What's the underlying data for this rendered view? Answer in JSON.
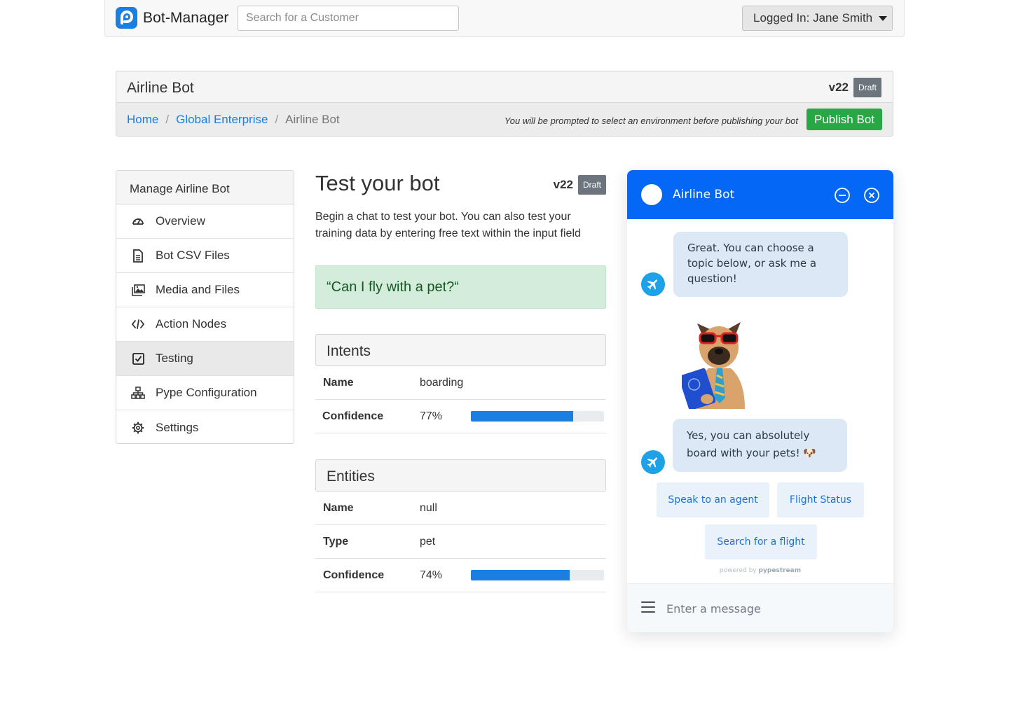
{
  "app": {
    "brand": "Bot-Manager",
    "search_placeholder": "Search for a Customer",
    "user_label": "Logged In: Jane Smith"
  },
  "bot_header": {
    "title": "Airline Bot",
    "version": "v22",
    "status": "Draft",
    "breadcrumb": [
      "Home",
      "Global Enterprise",
      "Airline Bot"
    ],
    "publish_note": "You will be prompted to select an environment before publishing your bot",
    "publish_label": "Publish Bot"
  },
  "sidebar": {
    "title": "Manage Airline Bot",
    "items": [
      {
        "label": "Overview",
        "icon": "dashboard-icon"
      },
      {
        "label": "Bot CSV Files",
        "icon": "file-icon"
      },
      {
        "label": "Media and Files",
        "icon": "images-icon"
      },
      {
        "label": "Action Nodes",
        "icon": "code-icon"
      },
      {
        "label": "Testing",
        "icon": "checkbox-icon",
        "active": true
      },
      {
        "label": "Pype Configuration",
        "icon": "sitemap-icon"
      },
      {
        "label": "Settings",
        "icon": "gear-icon"
      }
    ]
  },
  "main": {
    "title": "Test your bot",
    "version": "v22",
    "status": "Draft",
    "description": "Begin a chat to test your bot. You can also test your training data by entering free text within the input field",
    "utterance": "“Can I fly with a pet?“",
    "intents": {
      "heading": "Intents",
      "name_label": "Name",
      "name_value": "boarding",
      "confidence_label": "Confidence",
      "confidence_value": "77%",
      "confidence_fraction": 0.77
    },
    "entities": {
      "heading": "Entities",
      "name_label": "Name",
      "name_value": "null",
      "type_label": "Type",
      "type_value": "pet",
      "confidence_label": "Confidence",
      "confidence_value": "74%",
      "confidence_fraction": 0.74
    }
  },
  "chat": {
    "title": "Airline Bot",
    "messages": [
      "Great. You can choose a topic below, or ask me a question!",
      "Yes, you can absolutely board with your pets! 🐶"
    ],
    "quick_replies": [
      "Speak to an agent",
      "Flight Status",
      "Search for a flight"
    ],
    "powered_by_prefix": "powered by",
    "powered_by_brand": "pypestream",
    "input_placeholder": "Enter a message",
    "image_subject": "dog-with-passport"
  },
  "colors": {
    "primary": "#1a7fe0",
    "chat_header": "#0567f5",
    "success": "#28a745",
    "draft_badge": "#6c757d",
    "utterance_bg": "#d4edda",
    "bot_avatar": "#1ea1e6"
  }
}
